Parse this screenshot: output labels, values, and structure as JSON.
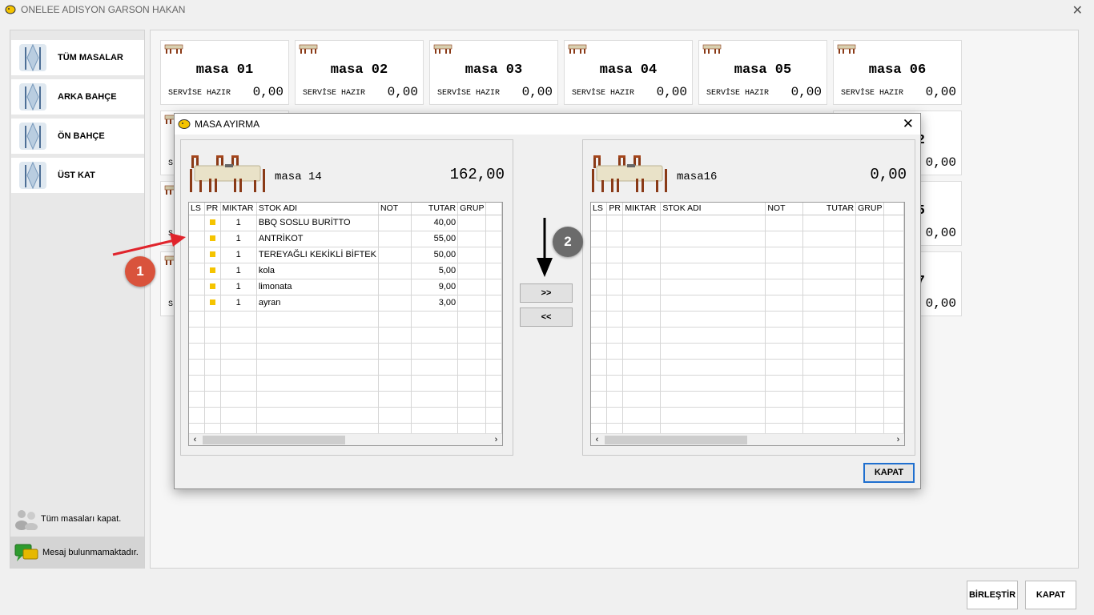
{
  "window": {
    "title": "ONELEE ADISYON GARSON HAKAN"
  },
  "sidebar": {
    "items": [
      {
        "label": "TÜM MASALAR"
      },
      {
        "label": "ARKA BAHÇE"
      },
      {
        "label": "ÖN BAHÇE"
      },
      {
        "label": "ÜST KAT"
      }
    ],
    "close_all_label": "Tüm masaları kapat.",
    "message_label": "Mesaj bulunmamaktadır."
  },
  "tables": [
    {
      "name": "masa 01",
      "status": "SERVİSE HAZIR",
      "amount": "0,00"
    },
    {
      "name": "masa 02",
      "status": "SERVİSE HAZIR",
      "amount": "0,00"
    },
    {
      "name": "masa 03",
      "status": "SERVİSE HAZIR",
      "amount": "0,00"
    },
    {
      "name": "masa 04",
      "status": "SERVİSE HAZIR",
      "amount": "0,00"
    },
    {
      "name": "masa 05",
      "status": "SERVİSE HAZIR",
      "amount": "0,00"
    },
    {
      "name": "masa 06",
      "status": "SERVİSE HAZIR",
      "amount": "0,00"
    }
  ],
  "hidden_cards": {
    "status_fragment": "S",
    "row2_name_fragment": "2",
    "row3_name_fragment": "5",
    "row4_name_fragment": "7",
    "amount": "0,00"
  },
  "dialog": {
    "title": "MASA AYIRMA",
    "columns": [
      "LS",
      "PR",
      "MIKTAR",
      "STOK ADI",
      "NOT",
      "TUTAR",
      "GRUP"
    ],
    "left": {
      "table_name": "masa 14",
      "total": "162,00",
      "rows": [
        {
          "qty": "1",
          "name": "BBQ SOSLU BURİTTO",
          "note": "",
          "price": "40,00"
        },
        {
          "qty": "1",
          "name": "ANTRİKOT",
          "note": "",
          "price": "55,00"
        },
        {
          "qty": "1",
          "name": "TEREYAĞLI KEKİKLİ BİFTEK",
          "note": "",
          "price": "50,00"
        },
        {
          "qty": "1",
          "name": "kola",
          "note": "",
          "price": "5,00"
        },
        {
          "qty": "1",
          "name": "limonata",
          "note": "",
          "price": "9,00"
        },
        {
          "qty": "1",
          "name": "ayran",
          "note": "",
          "price": "3,00"
        }
      ]
    },
    "right": {
      "table_name": "masa16",
      "total": "0,00",
      "rows": []
    },
    "move_right_label": ">>",
    "move_left_label": "<<",
    "close_label": "KAPAT"
  },
  "annotations": [
    {
      "label": "1"
    },
    {
      "label": "2"
    }
  ],
  "footer": {
    "merge_label": "BİRLEŞTİR",
    "close_label": "KAPAT"
  },
  "colors": {
    "accent_blue": "#1f6fcf",
    "pr_marker": "#f5c400",
    "badge_1": "#d9533c",
    "badge_2": "#6b6b6b",
    "arrow_red": "#e0242c"
  }
}
